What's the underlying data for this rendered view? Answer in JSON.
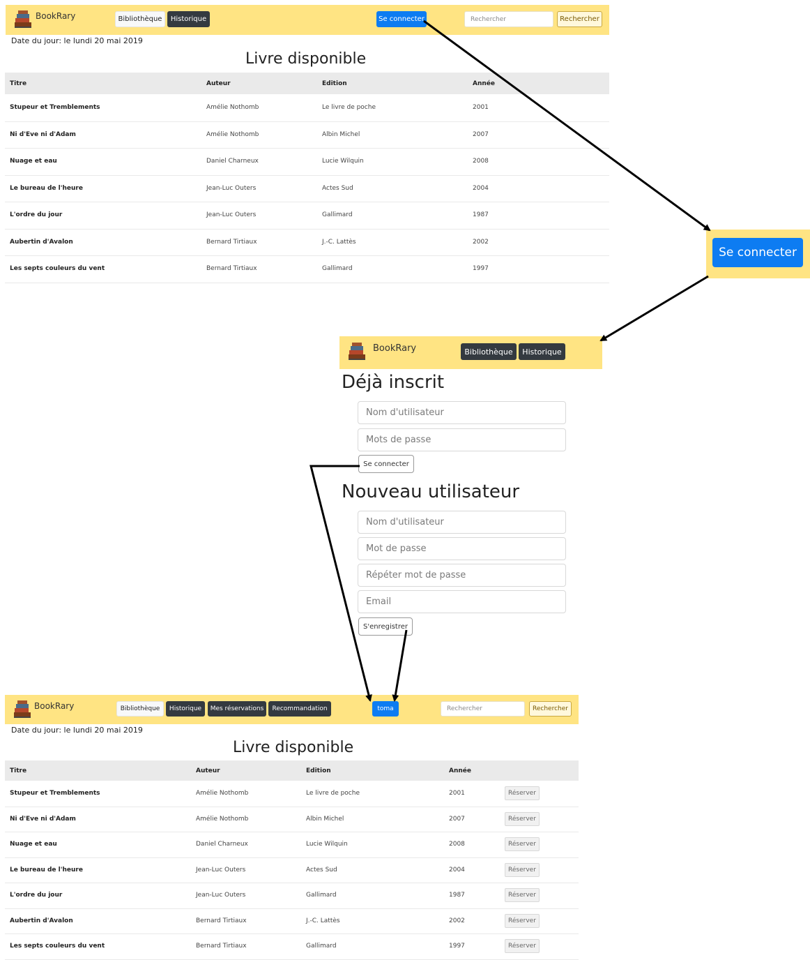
{
  "brand": "BookRary",
  "date_text": "Date du jour: le lundi 20 mai 2019",
  "page_title": "Livre disponible",
  "nav": {
    "bibliotheque": "Bibliothèque",
    "historique": "Historique",
    "mes_reservations": "Mes réservations",
    "recommandation": "Recommandation",
    "login": "Se connecter",
    "user": "toma",
    "search_placeholder": "Rechercher",
    "search_button": "Rechercher"
  },
  "table": {
    "headers": [
      "Titre",
      "Auteur",
      "Edition",
      "Année"
    ],
    "rows": [
      [
        "Stupeur et Tremblements",
        "Amélie Nothomb",
        "Le livre de poche",
        "2001"
      ],
      [
        "Ni d'Eve ni d'Adam",
        "Amélie Nothomb",
        "Albin Michel",
        "2007"
      ],
      [
        "Nuage et eau",
        "Daniel Charneux",
        "Lucie Wilquin",
        "2008"
      ],
      [
        "Le bureau de l'heure",
        "Jean-Luc Outers",
        "Actes Sud",
        "2004"
      ],
      [
        "L'ordre du jour",
        "Jean-Luc Outers",
        "Gallimard",
        "1987"
      ],
      [
        "Aubertin d'Avalon",
        "Bernard Tirtiaux",
        "J.-C. Lattès",
        "2002"
      ],
      [
        "Les septs couleurs du vent",
        "Bernard Tirtiaux",
        "Gallimard",
        "1997"
      ]
    ],
    "reserve_label": "Réserver"
  },
  "zoom_button": "Se connecter",
  "login_page": {
    "existing_title": "Déjà inscrit",
    "username_placeholder": "Nom d'utilisateur",
    "password_placeholder": "Mots de passe",
    "login_button": "Se connecter",
    "new_title": "Nouveau utilisateur",
    "new_username_placeholder": "Nom d'utilisateur",
    "new_password_placeholder": "Mot de passe",
    "repeat_password_placeholder": "Répéter mot de passe",
    "email_placeholder": "Email",
    "register_button": "S'enregistrer"
  },
  "colors": {
    "navbar": "#ffe483",
    "primary": "#0d7cf2",
    "dark": "#343a40",
    "arrow": "#000000"
  }
}
